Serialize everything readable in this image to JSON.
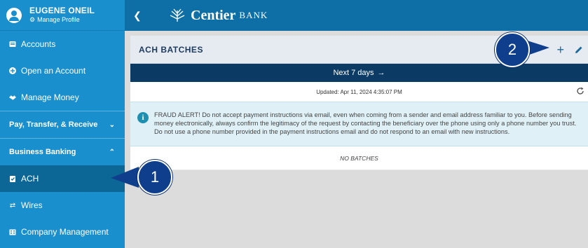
{
  "profile": {
    "name": "EUGENE ONEIL",
    "manage_label": "Manage Profile"
  },
  "sidebar": {
    "items": [
      {
        "label": "Accounts",
        "icon": "accounts-icon"
      },
      {
        "label": "Open an Account",
        "icon": "plus-circle-icon"
      },
      {
        "label": "Manage Money",
        "icon": "handshake-icon"
      }
    ],
    "groups": [
      {
        "label": "Pay, Transfer, & Receive",
        "chevron": "chevron-down-icon"
      },
      {
        "label": "Business Banking",
        "chevron": "chevron-up-icon"
      }
    ],
    "sub_items": [
      {
        "label": "ACH",
        "icon": "clipboard-check-icon",
        "active": true
      },
      {
        "label": "Wires",
        "icon": "transfer-icon"
      },
      {
        "label": "Company Management",
        "icon": "building-icon"
      }
    ]
  },
  "topbar": {
    "brand": "Centier",
    "bank": "BANK"
  },
  "panel": {
    "title": "ACH BATCHES",
    "add_label": "+",
    "next_label": "Next 7 days",
    "updated": "Updated: Apr 11, 2024 4:35:07 PM",
    "alert": "FRAUD ALERT! Do not accept payment instructions via email, even when coming from a sender and email address familiar to you. Before sending money electronically, always confirm the legitimacy of the request by contacting the beneficiary over the phone using only a phone number you trust. Do not use a phone number provided in the payment instructions email and do not respond to an email with new instructions.",
    "empty": "NO BATCHES"
  },
  "callouts": [
    "1",
    "2"
  ],
  "colors": {
    "sidebar": "#1a8fce",
    "active": "#0c6796",
    "topbar": "#0d6fa6",
    "nextbar": "#0b3a64",
    "callout": "#0f3f8c"
  }
}
